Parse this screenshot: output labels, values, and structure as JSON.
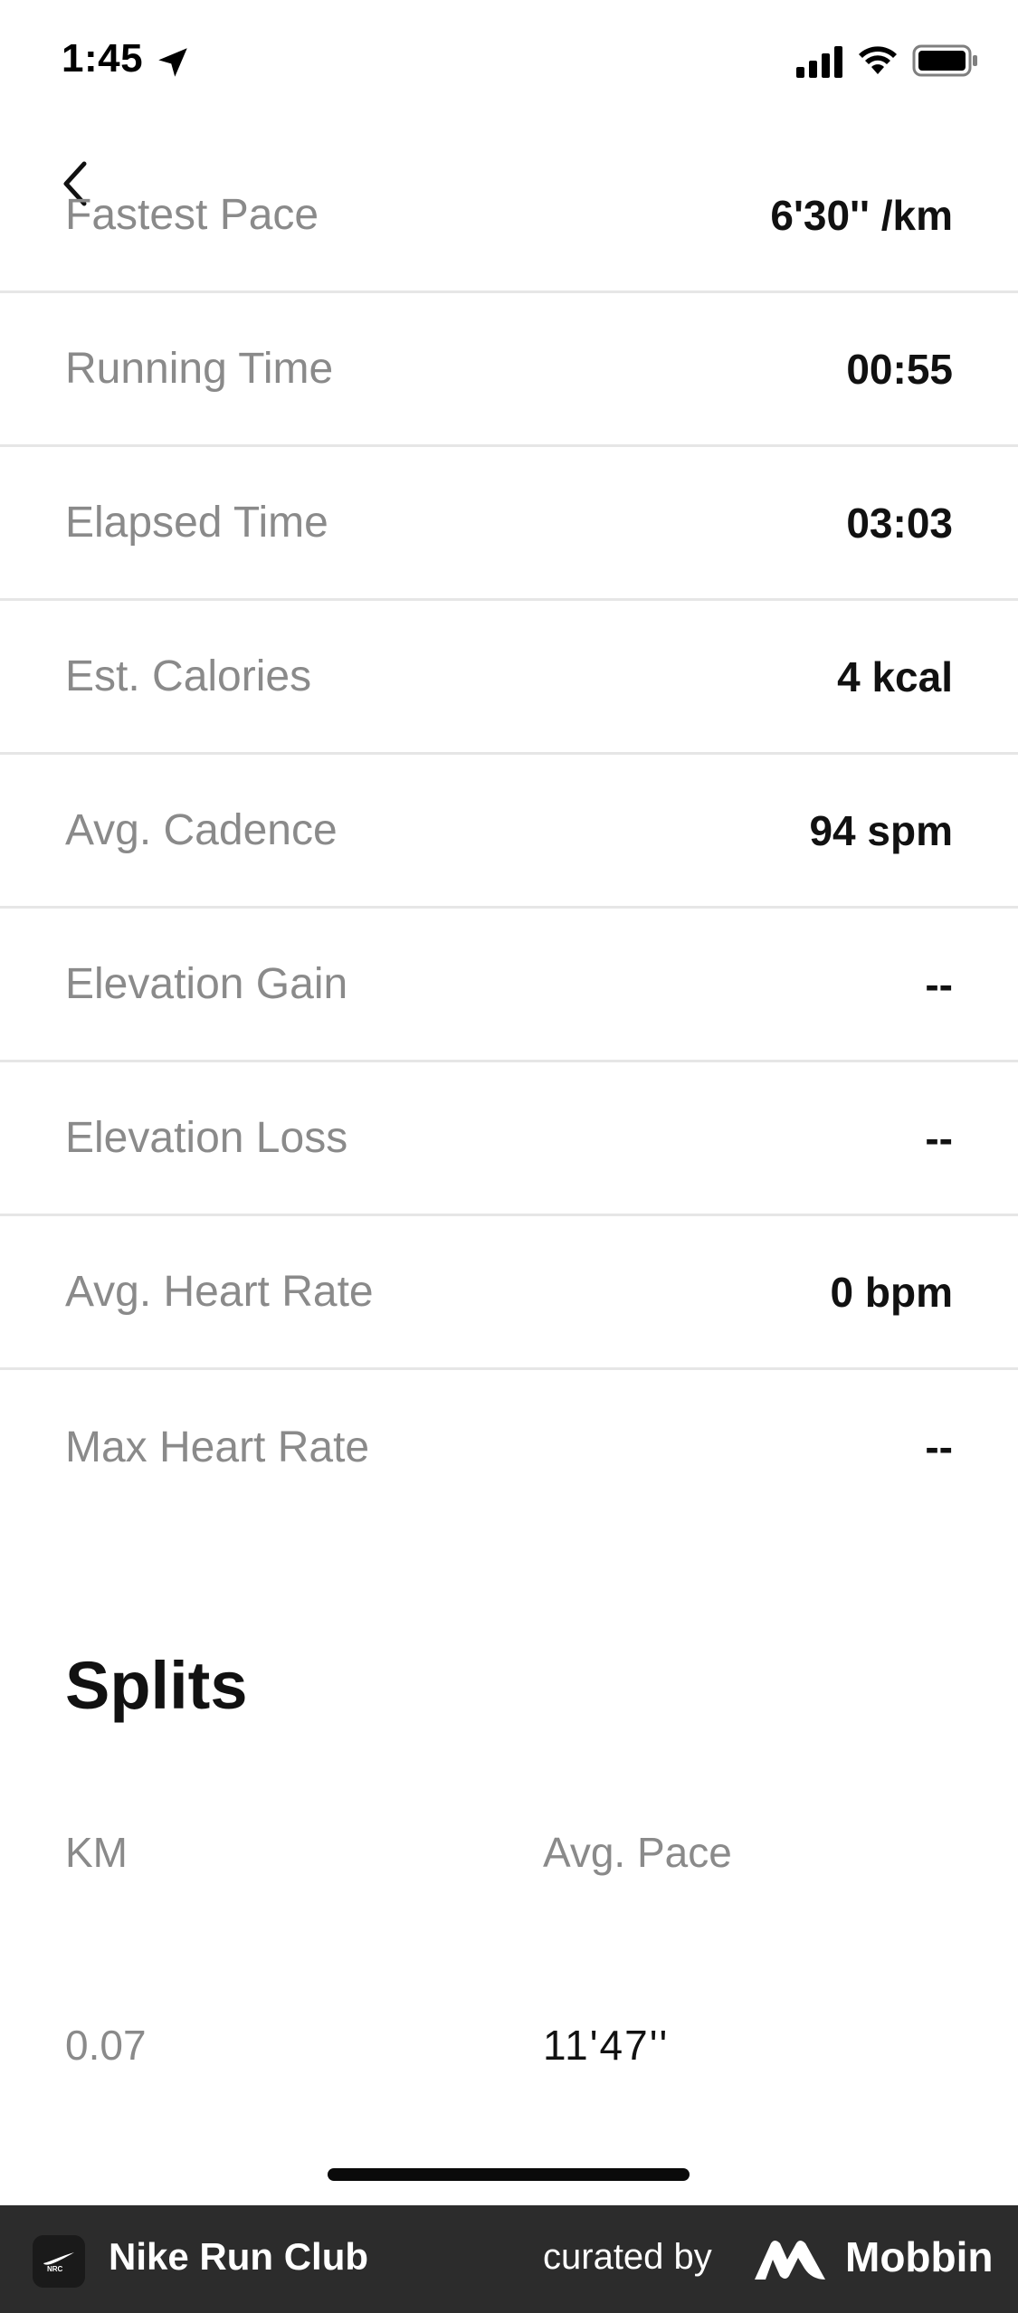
{
  "status_bar": {
    "time": "1:45"
  },
  "stats": [
    {
      "label": "Fastest Pace",
      "value": "6'30'' /km"
    },
    {
      "label": "Running Time",
      "value": "00:55"
    },
    {
      "label": "Elapsed Time",
      "value": "03:03"
    },
    {
      "label": "Est. Calories",
      "value": "4 kcal"
    },
    {
      "label": "Avg. Cadence",
      "value": "94 spm"
    },
    {
      "label": "Elevation Gain",
      "value": "--"
    },
    {
      "label": "Elevation Loss",
      "value": "--"
    },
    {
      "label": "Avg. Heart Rate",
      "value": "0 bpm"
    },
    {
      "label": "Max Heart Rate",
      "value": "--"
    }
  ],
  "splits": {
    "title": "Splits",
    "headers": {
      "km": "KM",
      "pace": "Avg. Pace"
    },
    "rows": [
      {
        "km": "0.07",
        "pace": "11'47''"
      }
    ]
  },
  "footer": {
    "app_name": "Nike Run Club",
    "curated_by": "curated by",
    "brand": "Mobbin"
  }
}
